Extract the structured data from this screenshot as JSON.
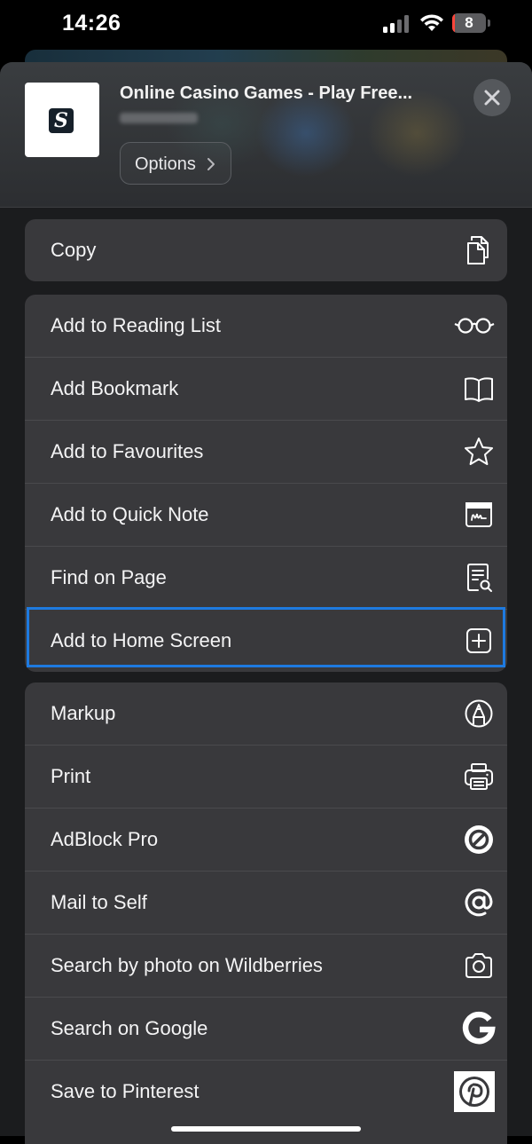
{
  "status_bar": {
    "time": "14:26",
    "battery_level": "8",
    "battery_fraction": 0.08,
    "battery_color": "#ff453a",
    "icons": [
      "signal-icon",
      "wifi-icon",
      "battery-icon"
    ]
  },
  "share_header": {
    "title": "Online Casino Games - Play Free...",
    "icon_letter": "S",
    "options_label": "Options",
    "close_icon": "close-icon"
  },
  "groups": [
    {
      "items": [
        {
          "label": "Copy",
          "icon": "copy-icon"
        }
      ]
    },
    {
      "items": [
        {
          "label": "Add to Reading List",
          "icon": "glasses-icon"
        },
        {
          "label": "Add Bookmark",
          "icon": "book-icon"
        },
        {
          "label": "Add to Favourites",
          "icon": "star-icon"
        },
        {
          "label": "Add to Quick Note",
          "icon": "quick-note-icon"
        },
        {
          "label": "Find on Page",
          "icon": "find-on-page-icon"
        },
        {
          "label": "Add to Home Screen",
          "icon": "plus-square-icon",
          "highlighted": true
        }
      ]
    },
    {
      "items": [
        {
          "label": "Markup",
          "icon": "markup-icon"
        },
        {
          "label": "Print",
          "icon": "printer-icon"
        },
        {
          "label": "AdBlock Pro",
          "icon": "adblock-icon"
        },
        {
          "label": "Mail to Self",
          "icon": "at-sign-icon"
        },
        {
          "label": "Search by photo on Wildberries",
          "icon": "camera-icon"
        },
        {
          "label": "Search on Google",
          "icon": "google-icon"
        },
        {
          "label": "Save to Pinterest",
          "icon": "pinterest-icon"
        }
      ]
    }
  ],
  "colors": {
    "highlight_border": "#1e7ae0",
    "row_background": "#39393c",
    "sheet_background": "#1b1c1e"
  }
}
